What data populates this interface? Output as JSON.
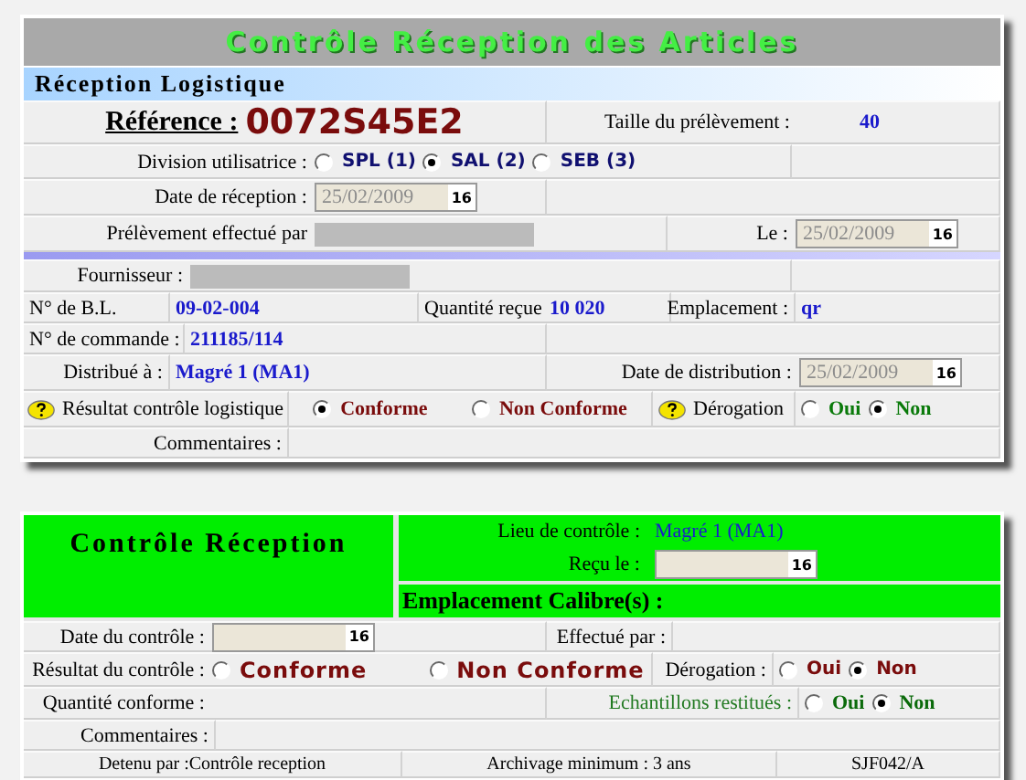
{
  "title": "Contrôle Réception des Articles",
  "section": "Réception Logistique",
  "reference": {
    "label": "Référence :",
    "value": "0072S45E2"
  },
  "sample_size": {
    "label": "Taille du prélèvement :",
    "value": "40"
  },
  "division": {
    "label": "Division utilisatrice :",
    "options": [
      {
        "label": "SPL (1)",
        "selected": false
      },
      {
        "label": "SAL (2)",
        "selected": true
      },
      {
        "label": "SEB (3)",
        "selected": false
      }
    ]
  },
  "reception_date": {
    "label": "Date de réception :",
    "value": "25/02/2009",
    "calendar": "16"
  },
  "sampling": {
    "label": "Prélèvement effectué par",
    "date_label": "Le :",
    "date": "25/02/2009",
    "calendar": "16"
  },
  "supplier": {
    "label": "Fournisseur :"
  },
  "delivery_note": {
    "label": "N° de B.L.",
    "value": "09-02-004"
  },
  "quantity": {
    "label": "Quantité reçue",
    "value": "10 020"
  },
  "location": {
    "label": "Emplacement :",
    "value": "qr"
  },
  "order": {
    "label": "N° de commande :",
    "value": "211185/114"
  },
  "distributed": {
    "label": "Distribué à :",
    "value": "Magré 1 (MA1)",
    "date_label": "Date de distribution :",
    "date": "25/02/2009",
    "calendar": "16"
  },
  "logistic_result": {
    "label": "Résultat contrôle logistique",
    "options": [
      {
        "label": "Conforme",
        "selected": true
      },
      {
        "label": "Non Conforme",
        "selected": false
      }
    ]
  },
  "derogation": {
    "label": "Dérogation",
    "options": [
      {
        "label": "Oui",
        "selected": false
      },
      {
        "label": "Non",
        "selected": true
      }
    ]
  },
  "comments": {
    "label": "Commentaires :"
  },
  "control": {
    "title": "Contrôle Réception",
    "place": {
      "label": "Lieu de contrôle :",
      "value": "Magré 1 (MA1)"
    },
    "received": {
      "label": "Reçu le :",
      "calendar": "16"
    },
    "calibre": {
      "label": "Emplacement Calibre(s) :"
    },
    "date": {
      "label": "Date du contrôle :",
      "calendar": "16"
    },
    "done_by": {
      "label": "Effectué par :"
    },
    "result": {
      "label": "Résultat du contrôle :",
      "options": [
        {
          "label": "Conforme",
          "selected": false
        },
        {
          "label": "Non Conforme",
          "selected": false
        }
      ]
    },
    "derogation": {
      "label": "Dérogation :",
      "options": [
        {
          "label": "Oui",
          "selected": false
        },
        {
          "label": "Non",
          "selected": true
        }
      ]
    },
    "quantity": {
      "label": "Quantité conforme :"
    },
    "samples": {
      "label": "Echantillons restitués :",
      "options": [
        {
          "label": "Oui",
          "selected": false
        },
        {
          "label": "Non",
          "selected": true
        }
      ]
    },
    "comments": {
      "label": "Commentaires :"
    },
    "footer": [
      "Detenu par :Contrôle reception",
      "Archivage minimum :  3 ans",
      "SJF042/A"
    ]
  }
}
